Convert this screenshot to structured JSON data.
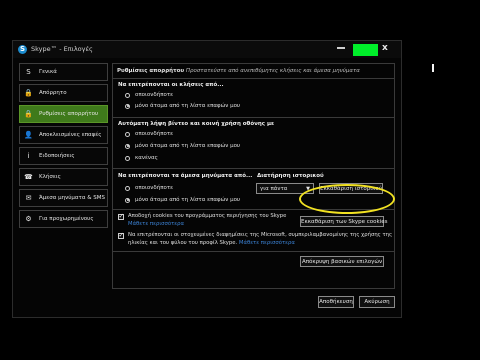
{
  "window": {
    "title": "Skype™ - Επιλογές",
    "title_icon": "skype-icon",
    "close_glyph": "x"
  },
  "sidebar": {
    "items": [
      {
        "label": "Γενικά",
        "icon": "skype-icon",
        "glyph": "S",
        "active": false
      },
      {
        "label": "Απόρρητο",
        "icon": "lock-icon",
        "glyph": "🔒",
        "active": false
      },
      {
        "label": "Ρυθμίσεις απορρήτου",
        "icon": "lock-icon",
        "glyph": "🔒",
        "active": true
      },
      {
        "label": "Αποκλεισμένες επαφές",
        "icon": "blocked-contacts-icon",
        "glyph": "👤",
        "active": false
      },
      {
        "label": "Ειδοποιήσεις",
        "icon": "info-icon",
        "glyph": "i",
        "active": false
      },
      {
        "label": "Κλήσεις",
        "icon": "phone-icon",
        "glyph": "☎",
        "active": false
      },
      {
        "label": "Άμεσα μηνύματα & SMS",
        "icon": "chat-icon",
        "glyph": "✉",
        "active": false
      },
      {
        "label": "Για προχωρημένους",
        "icon": "gear-icon",
        "glyph": "⚙",
        "active": false
      }
    ]
  },
  "panel": {
    "header_bold": "Ρυθμίσεις απορρήτου",
    "header_rest": " Προστατεύστε από ανεπιθύμητες κλήσεις και άμεσα μηνύματα",
    "calls": {
      "title": "Να επιτρέπονται οι κλήσεις από...",
      "options": [
        "οποιονδήποτε",
        "μόνο άτομα από τη λίστα επαφών μου"
      ],
      "selected": 1
    },
    "video": {
      "title": "Αυτόματη λήψη βίντεο και κοινή χρήση οθόνης με",
      "options": [
        "οποιονδήποτε",
        "μόνο άτομα από τη λίστα επαφών μου",
        "κανένας"
      ],
      "selected": 1
    },
    "im": {
      "title": "Να επιτρέπονται τα άμεσα μηνύματα από...",
      "options": [
        "οποιονδήποτε",
        "μόνο άτομα από τη λίστα επαφών μου"
      ],
      "selected": 1
    },
    "history": {
      "title": "Διατήρηση ιστορικού",
      "select_value": "για πάντα",
      "clear_button": "Εκκαθάριση ιστορικού"
    },
    "cookies": {
      "checked": true,
      "text": "Αποδοχή cookies του προγράμματος περιήγησης του Skype",
      "link": "Μάθετε περισσότερα",
      "button": "Εκκαθάριση των Skype cookies"
    },
    "ads": {
      "checked": true,
      "line1": "Να επιτρέπονται οι στοχευμένες διαφημίσεις της Microsoft, συμπεριλαμβανομένης της χρήσης της",
      "line2": "ηλικίας και του φύλου του προφίλ Skype.",
      "link": "Μάθετε περισσότερα"
    },
    "hide_button": "Απόκρυψη βασικών επιλογών"
  },
  "footer": {
    "save_button": "Αποθήκευση",
    "cancel_button": "Ακύρωση"
  },
  "colors": {
    "active_item": "#3f7a1b",
    "maximize_button": "#00ef2a",
    "highlight_ring": "#f2e222",
    "link": "#3c83d6"
  }
}
